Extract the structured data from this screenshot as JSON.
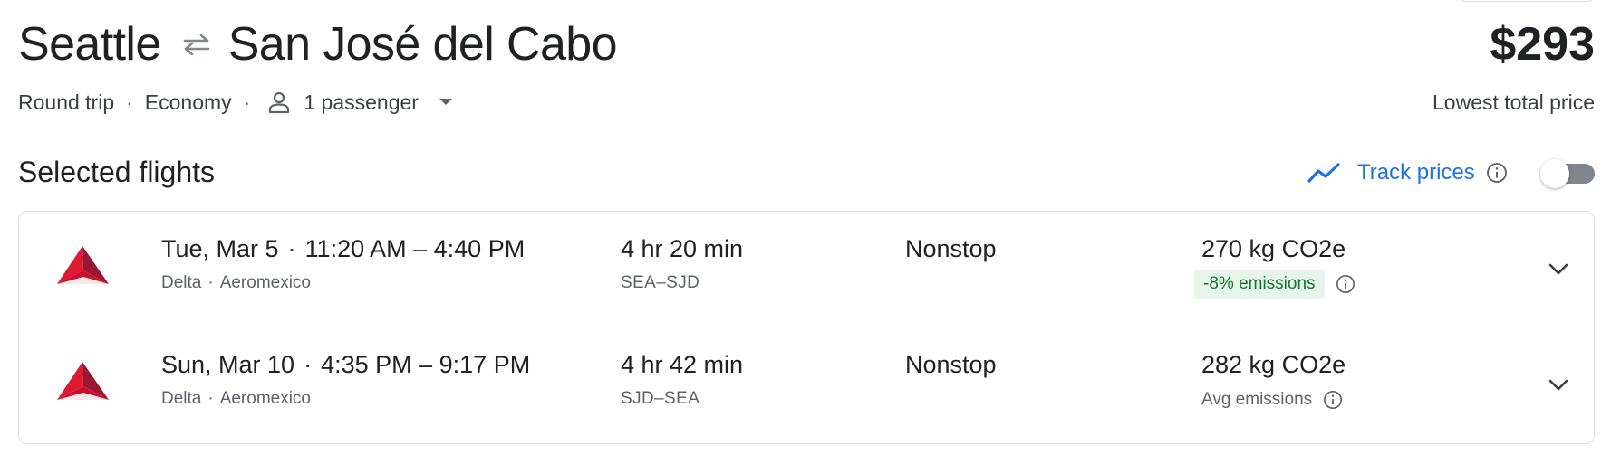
{
  "route": {
    "origin": "Seattle",
    "destination": "San José del Cabo",
    "swap_icon": "swap-arrows-icon"
  },
  "trip": {
    "type": "Round trip",
    "cabin": "Economy",
    "passengers": "1 passenger",
    "separator": "·"
  },
  "price": {
    "amount": "$293",
    "label": "Lowest total price"
  },
  "section": {
    "title": "Selected flights"
  },
  "track_prices": {
    "label": "Track prices",
    "enabled": false
  },
  "flights": [
    {
      "date": "Tue, Mar 5",
      "times": "11:20 AM – 4:40 PM",
      "airline": "Delta",
      "operator": "Aeromexico",
      "duration": "4 hr 20 min",
      "airports": "SEA–SJD",
      "stops": "Nonstop",
      "emissions": "270 kg CO2e",
      "emissions_note": "-8% emissions",
      "emissions_note_badge": true
    },
    {
      "date": "Sun, Mar 10",
      "times": "4:35 PM – 9:17 PM",
      "airline": "Delta",
      "operator": "Aeromexico",
      "duration": "4 hr 42 min",
      "airports": "SJD–SEA",
      "stops": "Nonstop",
      "emissions": "282 kg CO2e",
      "emissions_note": "Avg emissions",
      "emissions_note_badge": false
    }
  ],
  "colors": {
    "accent": "#1a73e8",
    "text": "#202124",
    "secondary": "#5f6368",
    "border": "#dadce0",
    "badge_bg": "#e6f4ea",
    "badge_text": "#137333",
    "delta_red": "#e01933",
    "delta_dark": "#9b1631"
  }
}
